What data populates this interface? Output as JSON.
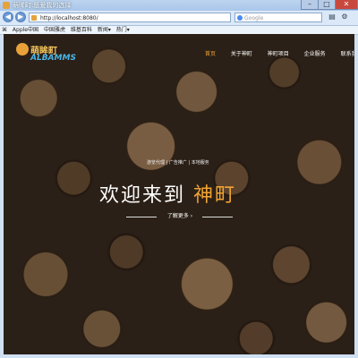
{
  "window": {
    "title": "萌眸町:愿爱我的选择"
  },
  "browser": {
    "address": "http://localhost:8080/",
    "search_placeholder": "Google"
  },
  "bookmarks": [
    "Apple中国",
    "中国雅虎",
    "维基百科",
    "新闻▾",
    "热门▾"
  ],
  "site": {
    "logo_top": "萌眸町",
    "logo_bottom": "ALBAMMS",
    "menu": [
      {
        "label": "首页",
        "active": true
      },
      {
        "label": "关于神町",
        "active": false
      },
      {
        "label": "神町项目",
        "active": false
      },
      {
        "label": "企业服务",
        "active": false
      },
      {
        "label": "联系我们",
        "active": false
      }
    ],
    "breadcrumb": "游览代理 | 广告推广 | 本地服务",
    "hero_prefix": "欢迎来到",
    "hero_highlight": "神町",
    "cta": "了解更多 ›"
  },
  "colors": {
    "accent": "#f2a533",
    "logo_blue": "#49b6e8"
  }
}
